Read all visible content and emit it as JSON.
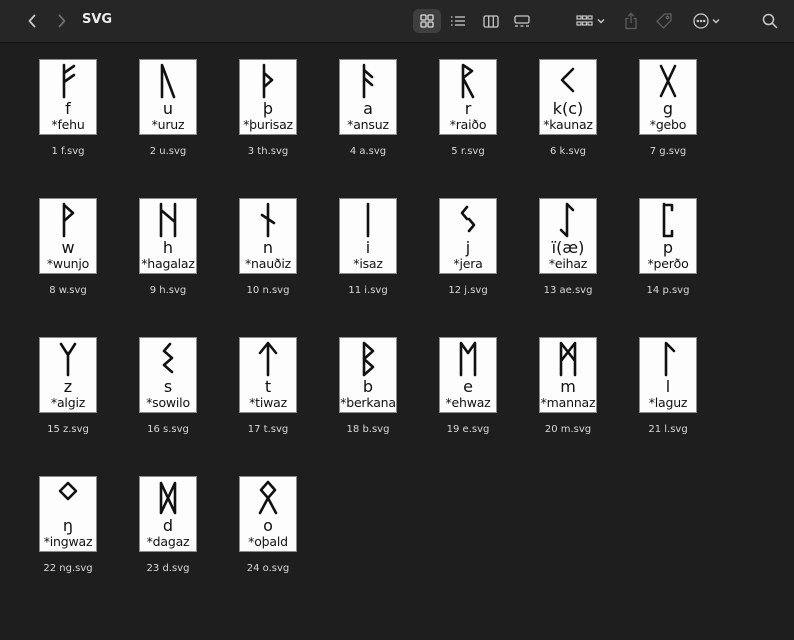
{
  "window": {
    "title": "SVG"
  },
  "toolbar": {
    "back_icon": "chevron-left-icon",
    "forward_icon": "chevron-right-icon",
    "views": [
      "grid-view-icon",
      "list-view-icon",
      "column-view-icon",
      "gallery-view-icon"
    ],
    "group_icon": "group-by-icon",
    "share_icon": "share-icon",
    "tag_icon": "tag-icon",
    "more_icon": "more-actions-icon",
    "search_icon": "search-icon"
  },
  "files": [
    {
      "latin": "f",
      "name": "*fehu",
      "file": "1 f.svg"
    },
    {
      "latin": "u",
      "name": "*uruz",
      "file": "2 u.svg"
    },
    {
      "latin": "þ",
      "name": "*þurisaz",
      "file": "3 th.svg"
    },
    {
      "latin": "a",
      "name": "*ansuz",
      "file": "4 a.svg"
    },
    {
      "latin": "r",
      "name": "*raiðo",
      "file": "5 r.svg"
    },
    {
      "latin": "k(c)",
      "name": "*kaunaz",
      "file": "6 k.svg"
    },
    {
      "latin": "g",
      "name": "*gebo",
      "file": "7 g.svg"
    },
    {
      "latin": "w",
      "name": "*wunjo",
      "file": "8 w.svg"
    },
    {
      "latin": "h",
      "name": "*hagalaz",
      "file": "9 h.svg"
    },
    {
      "latin": "n",
      "name": "*nauðiz",
      "file": "10 n.svg"
    },
    {
      "latin": "i",
      "name": "*isaz",
      "file": "11 i.svg"
    },
    {
      "latin": "j",
      "name": "*jera",
      "file": "12 j.svg"
    },
    {
      "latin": "ï(æ)",
      "name": "*eihaz",
      "file": "13 ae.svg"
    },
    {
      "latin": "p",
      "name": "*perðo",
      "file": "14 p.svg"
    },
    {
      "latin": "z",
      "name": "*algiz",
      "file": "15 z.svg"
    },
    {
      "latin": "s",
      "name": "*sowilo",
      "file": "16 s.svg"
    },
    {
      "latin": "t",
      "name": "*tiwaz",
      "file": "17 t.svg"
    },
    {
      "latin": "b",
      "name": "*berkana",
      "file": "18 b.svg"
    },
    {
      "latin": "e",
      "name": "*ehwaz",
      "file": "19 e.svg"
    },
    {
      "latin": "m",
      "name": "*mannaz",
      "file": "20 m.svg"
    },
    {
      "latin": "l",
      "name": "*laguz",
      "file": "21 l.svg"
    },
    {
      "latin": "ŋ",
      "name": "*ingwaz",
      "file": "22 ng.svg"
    },
    {
      "latin": "d",
      "name": "*dagaz",
      "file": "23 d.svg"
    },
    {
      "latin": "o",
      "name": "*oþald",
      "file": "24 o.svg"
    }
  ]
}
